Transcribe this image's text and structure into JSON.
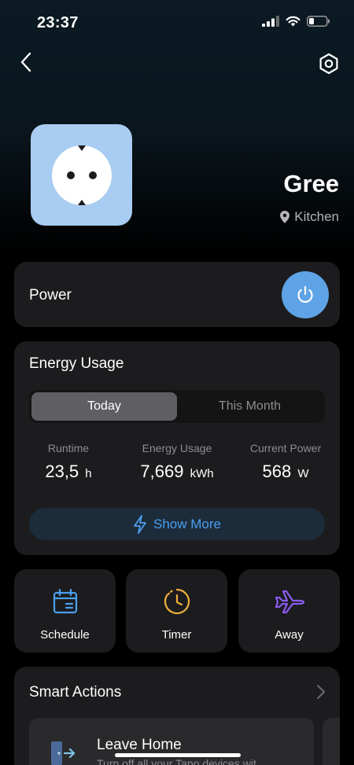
{
  "status_bar": {
    "time": "23:37"
  },
  "device": {
    "name": "Gree",
    "location": "Kitchen"
  },
  "power": {
    "label": "Power",
    "state": "on"
  },
  "energy": {
    "title": "Energy Usage",
    "tabs": [
      {
        "label": "Today",
        "active": true
      },
      {
        "label": "This Month",
        "active": false
      }
    ],
    "stats": [
      {
        "label": "Runtime",
        "value": "23,5",
        "unit": "h"
      },
      {
        "label": "Energy Usage",
        "value": "7,669",
        "unit": "kWh"
      },
      {
        "label": "Current Power",
        "value": "568",
        "unit": "W"
      }
    ],
    "show_more": "Show More"
  },
  "quick_actions": [
    {
      "label": "Schedule",
      "icon": "calendar-icon",
      "color": "#4b9ef0"
    },
    {
      "label": "Timer",
      "icon": "clock-icon",
      "color": "#f0b03c"
    },
    {
      "label": "Away",
      "icon": "airplane-icon",
      "color": "#8a5cf0"
    }
  ],
  "smart_actions": {
    "title": "Smart Actions",
    "items": [
      {
        "title": "Leave Home",
        "description": "Turn off all your Tapo devices wit",
        "icon": "door-exit-icon"
      }
    ]
  },
  "colors": {
    "accent_blue": "#4b9ef0",
    "power_button": "#5ea3e6",
    "device_tile": "#a9ccf2",
    "card_bg": "#1c1c1e"
  }
}
